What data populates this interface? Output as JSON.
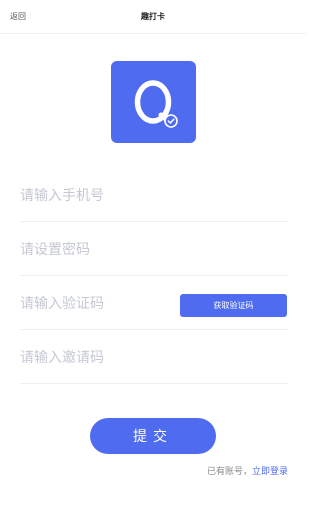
{
  "navbar": {
    "back_label": "返回",
    "title": "趣打卡"
  },
  "logo": {
    "icon": "app-logo-q-icon",
    "color": "#4f6cf0"
  },
  "form": {
    "phone_placeholder": "请输入手机号",
    "password_placeholder": "请设置密码",
    "code_placeholder": "请输入验证码",
    "get_code_label": "获取验证码",
    "invite_placeholder": "请输入邀请码",
    "submit_label": "提交"
  },
  "footer": {
    "has_account_text": "已有账号，",
    "login_link": "立即登录"
  },
  "colors": {
    "accent": "#4f6cf0",
    "placeholder": "#c5c8d2"
  }
}
